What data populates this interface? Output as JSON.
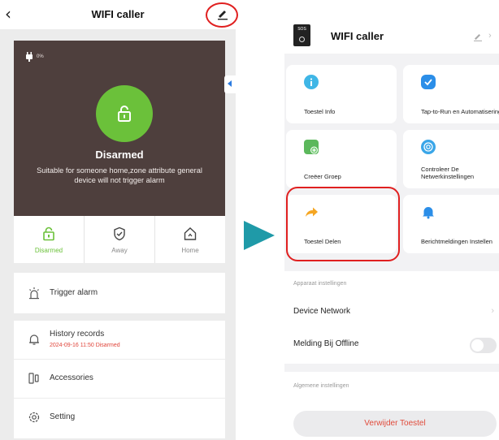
{
  "left": {
    "header": {
      "back_icon": "back-arrow-icon",
      "title": "WIFI caller",
      "edit_icon": "edit-pen-icon"
    },
    "panel": {
      "battery_percent": "0%",
      "status": "Disarmed",
      "description": "Suitable for someone home,zone attribute general device will not trigger alarm",
      "bg_color": "#4e3f3d",
      "accent_color": "#6bc13a"
    },
    "modes": [
      {
        "label": "Disarmed",
        "icon": "unlock-icon",
        "active": true
      },
      {
        "label": "Away",
        "icon": "shield-check-icon",
        "active": false
      },
      {
        "label": "Home",
        "icon": "home-icon",
        "active": false
      }
    ],
    "trigger_alarm": {
      "label": "Trigger alarm",
      "icon": "siren-icon"
    },
    "history": {
      "label": "History records",
      "sub": "2024-09-16 11:50 Disarmed",
      "icon": "bell-icon"
    },
    "accessories": {
      "label": "Accessories",
      "icon": "accessories-icon"
    },
    "setting": {
      "label": "Setting",
      "icon": "gear-icon"
    }
  },
  "right": {
    "header": {
      "thumb_label": "SOS",
      "title": "WIFI caller"
    },
    "tiles": [
      {
        "label": "Toestel Info",
        "icon": "info-icon",
        "color": "#3fb6e6"
      },
      {
        "label": "Tap-to-Run en Automatisering",
        "icon": "check-badge-icon",
        "color": "#2b8ee8"
      },
      {
        "label": "Creëer Groep",
        "icon": "group-add-icon",
        "color": "#5cb85c"
      },
      {
        "label": "Controleer De Netwerkinstellingen",
        "icon": "network-icon",
        "color": "#3aa6e8"
      },
      {
        "label": "Toestel Delen",
        "icon": "share-arrow-icon",
        "color": "#f5a623"
      },
      {
        "label": "Berichtmeldingen Instellen",
        "icon": "notification-bell-icon",
        "color": "#2b8ee8"
      }
    ],
    "device_settings": {
      "title": "Apparaat instellingen",
      "network": "Device Network",
      "offline": "Melding Bij Offline"
    },
    "general_settings": {
      "title": "Algemene instellingen"
    },
    "delete_button": "Verwijder Toestel"
  },
  "colors": {
    "highlight": "#e02020",
    "arrow": "#1f9aa8"
  }
}
